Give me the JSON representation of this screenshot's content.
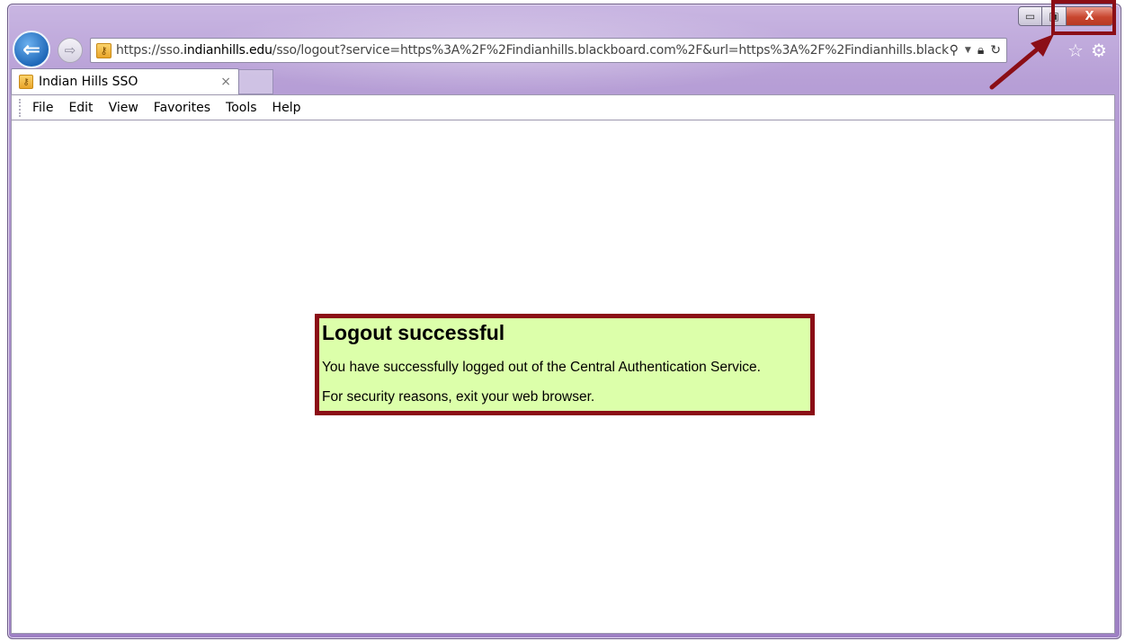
{
  "browser": {
    "url_protocol": "https://sso.",
    "url_domain": "indianhills.edu",
    "url_path": "/sso/logout?service=https%3A%2F%2Findianhills.blackboard.com%2F&url=https%3A%2F%2Findianhills.black",
    "tab_title": "Indian Hills SSO",
    "tab_close": "×",
    "menu": [
      "File",
      "Edit",
      "View",
      "Favorites",
      "Tools",
      "Help"
    ],
    "caption": {
      "minimize": "▭",
      "maximize": "▣",
      "close": "X"
    },
    "icons": {
      "back": "back-arrow-icon",
      "forward": "forward-arrow-icon",
      "search": "search-icon",
      "lock": "lock-icon",
      "refresh": "refresh-icon",
      "favorites": "star-icon",
      "tools": "gear-icon"
    }
  },
  "page": {
    "title": "Logout successful",
    "line1": "You have successfully logged out of the Central Authentication Service.",
    "line2": "For security reasons, exit your web browser."
  },
  "colors": {
    "highlight_border": "#8b0e16",
    "message_background": "#dcffaa",
    "window_frame": "#a98ccb"
  }
}
